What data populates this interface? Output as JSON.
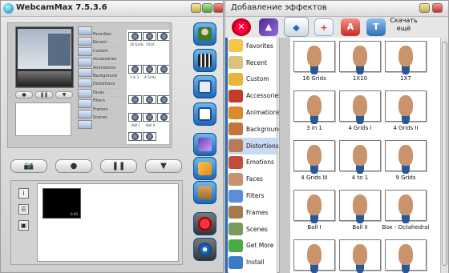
{
  "left_window": {
    "title": "WebcamMax  7.5.3.6",
    "preview_controls": [
      "●",
      "❚❚",
      "▼"
    ],
    "mini_categories": [
      "Favorites",
      "Recent",
      "Custom",
      "Accessories",
      "Animations",
      "Background",
      "Distortions",
      "Faces",
      "Filters",
      "Frames",
      "Scenes"
    ],
    "mini_labels": [
      "16 Grids",
      "1X10",
      "3 in 1",
      "4 Grids",
      "Ball I",
      "Ball II"
    ],
    "controls": {
      "snapshot": "📷",
      "record": "●",
      "pause": "❚❚",
      "download": "▼"
    },
    "side_buttons": [
      "i",
      "☰",
      "▣"
    ],
    "video_counter": "0:00"
  },
  "effects_window": {
    "title": "Добавление эффектов",
    "download_more": "Скачать ещё",
    "categories": [
      {
        "label": "Favorites",
        "color": "#f3c54a"
      },
      {
        "label": "Recent",
        "color": "#d9c27c"
      },
      {
        "label": "Custom",
        "color": "#e7b53c"
      },
      {
        "label": "Accessories",
        "color": "#c23b2b"
      },
      {
        "label": "Animations",
        "color": "#d98a2c"
      },
      {
        "label": "Background",
        "color": "#c4763a"
      },
      {
        "label": "Distortions",
        "color": "#b77b58",
        "selected": true
      },
      {
        "label": "Emotions",
        "color": "#c14e3b"
      },
      {
        "label": "Faces",
        "color": "#c99171"
      },
      {
        "label": "Filters",
        "color": "#5a8fd6"
      },
      {
        "label": "Frames",
        "color": "#a57b4c"
      },
      {
        "label": "Scenes",
        "color": "#7a9a5c"
      },
      {
        "label": "Get More",
        "color": "#4caa45"
      },
      {
        "label": "Install",
        "color": "#3c7bc7"
      }
    ],
    "effects": [
      {
        "label": "16 Grids"
      },
      {
        "label": "1X10"
      },
      {
        "label": "1X7"
      },
      {
        "label": "3 in 1"
      },
      {
        "label": "4 Grids I"
      },
      {
        "label": "4 Grids II"
      },
      {
        "label": "4 Grids III"
      },
      {
        "label": "4 to 1"
      },
      {
        "label": "9 Grids"
      },
      {
        "label": "Ball I"
      },
      {
        "label": "Ball II"
      },
      {
        "label": "Box - Octahedral"
      },
      {
        "label": ""
      },
      {
        "label": ""
      },
      {
        "label": ""
      }
    ]
  }
}
